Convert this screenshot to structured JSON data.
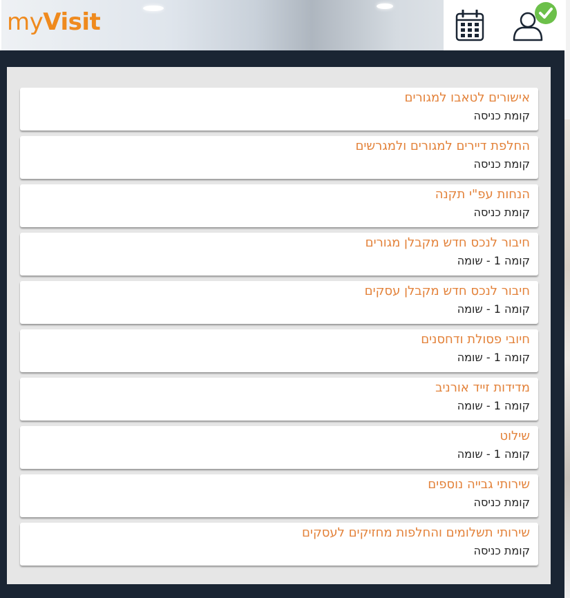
{
  "header": {
    "logo_prefix": "my",
    "logo_suffix": "Visit",
    "calendar_icon": "calendar-icon",
    "profile_icon": "user-check-icon",
    "accent_color": "#ef8a1e",
    "check_color": "#6cc04a"
  },
  "services": [
    {
      "title": "אישורים לטאבו למגורים",
      "floor": "קומת כניסה"
    },
    {
      "title": "החלפת דיירים למגורים ולמגרשים",
      "floor": "קומת כניסה"
    },
    {
      "title": "הנחות עפ\"י תקנה",
      "floor": "קומת כניסה"
    },
    {
      "title": "חיבור לנכס חדש מקבלן מגורים",
      "floor": "קומה 1 - שומה"
    },
    {
      "title": "חיבור לנכס חדש מקבלן עסקים",
      "floor": "קומה 1 - שומה"
    },
    {
      "title": "חיובי פסולת ודחסנים",
      "floor": "קומה 1 - שומה"
    },
    {
      "title": "מדידות זייד אורניב",
      "floor": "קומה 1 - שומה"
    },
    {
      "title": "שילוט",
      "floor": "קומה 1 - שומה"
    },
    {
      "title": "שירותי גבייה נוספים",
      "floor": "קומת כניסה"
    },
    {
      "title": "שירותי תשלומים והחלפות מחזיקים לעסקים",
      "floor": "קומת כניסה"
    }
  ],
  "colors": {
    "title": "#e3823a",
    "background": "#1a2533",
    "panel": "#e6e6e6"
  }
}
